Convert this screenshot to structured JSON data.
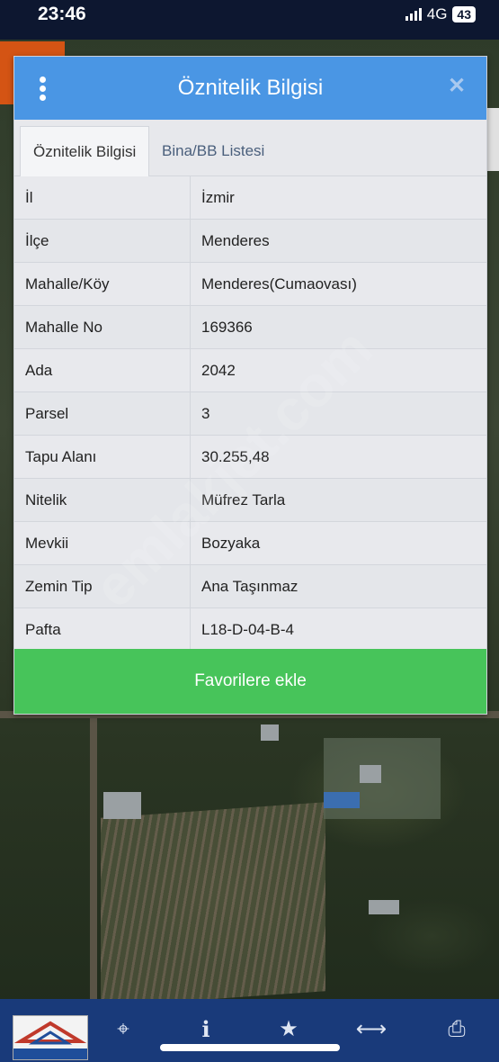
{
  "status_bar": {
    "time": "23:46",
    "network": "4G",
    "battery": "43"
  },
  "panel": {
    "title": "Öznitelik Bilgisi",
    "tabs": [
      {
        "label": "Öznitelik Bilgisi",
        "active": true
      },
      {
        "label": "Bina/BB Listesi",
        "active": false
      }
    ],
    "rows": [
      {
        "key": "İl",
        "value": "İzmir"
      },
      {
        "key": "İlçe",
        "value": "Menderes"
      },
      {
        "key": "Mahalle/Köy",
        "value": "Menderes(Cumaovası)"
      },
      {
        "key": "Mahalle No",
        "value": "169366"
      },
      {
        "key": "Ada",
        "value": "2042"
      },
      {
        "key": "Parsel",
        "value": "3"
      },
      {
        "key": "Tapu Alanı",
        "value": "30.255,48"
      },
      {
        "key": "Nitelik",
        "value": "Müfrez Tarla"
      },
      {
        "key": "Mevkii",
        "value": "Bozyaka"
      },
      {
        "key": "Zemin Tip",
        "value": "Ana Taşınmaz"
      },
      {
        "key": "Pafta",
        "value": "L18-D-04-B-4"
      }
    ],
    "favorite_button": "Favorilere ekle"
  },
  "watermark": "emlakjet.com",
  "logo_text": "ARAS EMLAK",
  "toolbar": {
    "icons": [
      "logo",
      "locate-icon",
      "info-icon",
      "star-icon",
      "measure-icon",
      "print-icon"
    ]
  },
  "colors": {
    "header": "#4a96e4",
    "favorite_button": "#47c45a",
    "toolbar": "#193a7a",
    "status_bar": "#0d1730"
  }
}
